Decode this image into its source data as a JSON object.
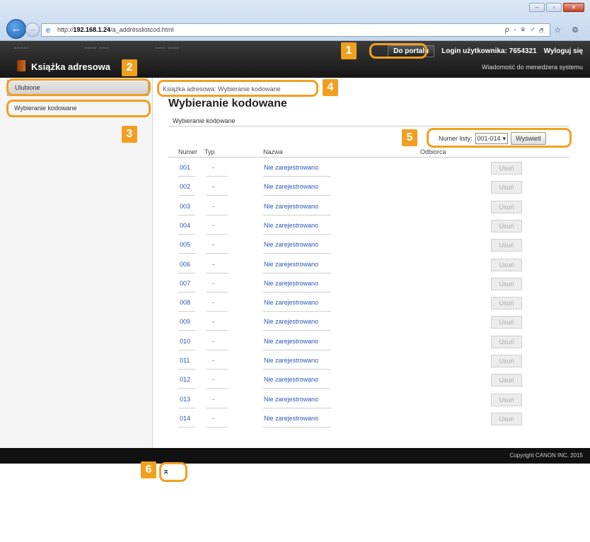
{
  "browser": {
    "url_prefix": "http://",
    "url_host": "192.168.1.24",
    "url_path": "/a_addresslistcod.html",
    "addr_tools": "ρ - ≡ ♂ ×",
    "right_icons": "⌂ ☆ ⚙"
  },
  "header": {
    "app_title": "Książka adresowa",
    "portal_button": "Do portalu",
    "login_label": "Login użytkownika: 7654321",
    "logout_link": "Wyloguj się",
    "manager_message": "Wiadomość do menedżera systemu"
  },
  "sidebar": {
    "items": [
      {
        "label": "Ulubione"
      },
      {
        "label": "Wybieranie kodowane"
      }
    ]
  },
  "main": {
    "breadcrumb": "Książka adresowa: Wybieranie kodowane",
    "title": "Wybieranie kodowane",
    "section_title": "Wybieranie kodowane",
    "list_label": "Numer listy:",
    "list_value": "001-014",
    "show_button": "Wyświetl",
    "columns": {
      "num": "Numer",
      "type": "Typ",
      "name": "Nazwa",
      "recipient": "Odbiorca"
    },
    "rows": [
      {
        "num": "001",
        "type": "-",
        "name": "Nie zarejestrowano",
        "action": "Usuń"
      },
      {
        "num": "002",
        "type": "-",
        "name": "Nie zarejestrowano",
        "action": "Usuń"
      },
      {
        "num": "003",
        "type": "-",
        "name": "Nie zarejestrowano",
        "action": "Usuń"
      },
      {
        "num": "004",
        "type": "-",
        "name": "Nie zarejestrowano",
        "action": "Usuń"
      },
      {
        "num": "005",
        "type": "-",
        "name": "Nie zarejestrowano",
        "action": "Usuń"
      },
      {
        "num": "006",
        "type": "-",
        "name": "Nie zarejestrowano",
        "action": "Usuń"
      },
      {
        "num": "007",
        "type": "-",
        "name": "Nie zarejestrowano",
        "action": "Usuń"
      },
      {
        "num": "008",
        "type": "-",
        "name": "Nie zarejestrowano",
        "action": "Usuń"
      },
      {
        "num": "009",
        "type": "-",
        "name": "Nie zarejestrowano",
        "action": "Usuń"
      },
      {
        "num": "010",
        "type": "-",
        "name": "Nie zarejestrowano",
        "action": "Usuń"
      },
      {
        "num": "011",
        "type": "-",
        "name": "Nie zarejestrowano",
        "action": "Usuń"
      },
      {
        "num": "012",
        "type": "-",
        "name": "Nie zarejestrowano",
        "action": "Usuń"
      },
      {
        "num": "013",
        "type": "-",
        "name": "Nie zarejestrowano",
        "action": "Usuń"
      },
      {
        "num": "014",
        "type": "-",
        "name": "Nie zarejestrowano",
        "action": "Usuń"
      }
    ],
    "to_top_glyph": "⌅"
  },
  "footer": {
    "copyright": "Copyright CANON INC. 2015"
  },
  "callouts": [
    "1",
    "2",
    "3",
    "4",
    "5",
    "6"
  ],
  "colors": {
    "callout": "#f0a020",
    "link": "#2d57b6",
    "header_bg": "#1f1f1f"
  }
}
